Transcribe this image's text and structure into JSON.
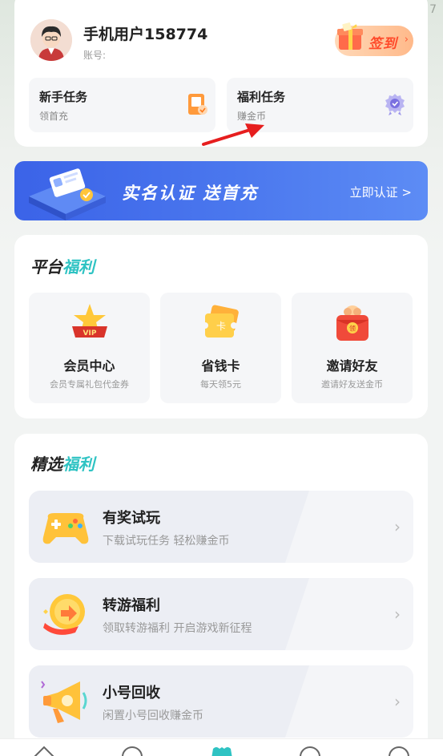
{
  "status_bar": {
    "corner_digit": "7"
  },
  "user": {
    "name": "手机用户158774",
    "account_label": "账号:",
    "signin_label": "签到"
  },
  "tasks": [
    {
      "title": "新手任务",
      "subtitle": "领首充",
      "icon": "phone-card-icon"
    },
    {
      "title": "福利任务",
      "subtitle": "赚金币",
      "icon": "badge-icon"
    }
  ],
  "banner": {
    "title": "实名认证 送首充",
    "cta": "立即认证 >"
  },
  "platform": {
    "title_prefix": "平台",
    "title_accent": "福利",
    "items": [
      {
        "name": "会员中心",
        "desc": "会员专属礼包代金券",
        "icon": "vip-crown-icon"
      },
      {
        "name": "省钱卡",
        "desc": "每天领5元",
        "icon": "ticket-card-icon"
      },
      {
        "name": "邀请好友",
        "desc": "邀请好友送金币",
        "icon": "red-envelope-icon"
      }
    ]
  },
  "featured": {
    "title_prefix": "精选",
    "title_accent": "福利",
    "items": [
      {
        "name": "有奖试玩",
        "desc": "下载试玩任务 轻松赚金币",
        "icon": "gamepad-icon"
      },
      {
        "name": "转游福利",
        "desc": "领取转游福利 开启游戏新征程",
        "icon": "coin-swap-icon"
      },
      {
        "name": "小号回收",
        "desc": "闲置小号回收赚金币",
        "icon": "megaphone-icon"
      }
    ]
  },
  "colors": {
    "accent_teal": "#2fc3c3",
    "banner_blue": "#3b63e8",
    "signin_red": "#ff4a2a"
  }
}
